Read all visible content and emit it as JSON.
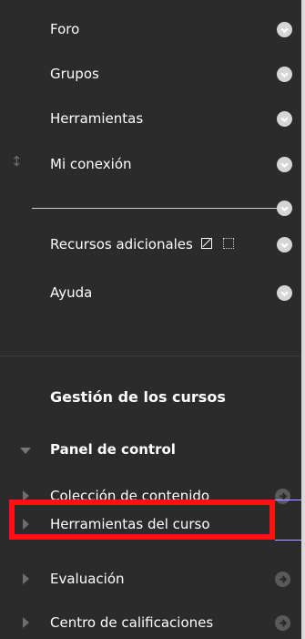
{
  "menu": {
    "items": [
      {
        "label": "Foro"
      },
      {
        "label": "Grupos"
      },
      {
        "label": "Herramientas"
      },
      {
        "label": "Mi conexión"
      },
      {
        "label": "Recursos adicionales"
      },
      {
        "label": "Ayuda"
      }
    ]
  },
  "management": {
    "title": "Gestión de los cursos",
    "panel_title": "Panel de control",
    "items": [
      {
        "label": "Colección de contenido"
      },
      {
        "label": "Herramientas del curso"
      },
      {
        "label": "Evaluación"
      },
      {
        "label": "Centro de calificaciones"
      }
    ]
  },
  "colors": {
    "background": "#2b2b2b",
    "highlight": "#ff1111",
    "button_light": "#d6d6d6",
    "button_dark": "#5a5a5a"
  },
  "icons": {
    "chevron": "chevron-down-icon",
    "arrow": "arrow-right-icon",
    "drag": "drag-handle-icon"
  }
}
